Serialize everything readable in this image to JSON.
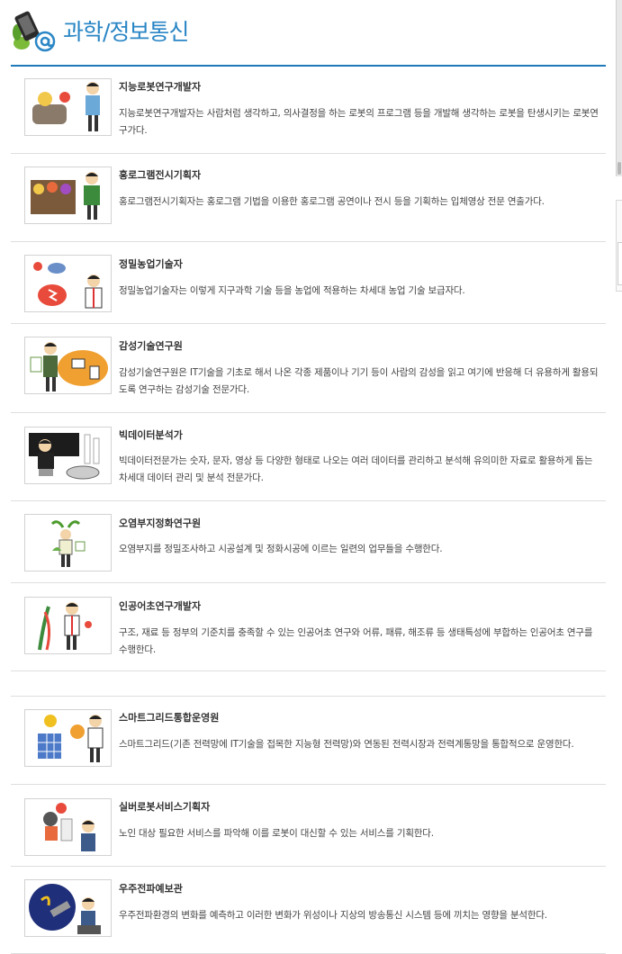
{
  "header": {
    "title": "과학/정보통신"
  },
  "jobs": [
    {
      "title": "지능로봇연구개발자",
      "desc": "지능로봇연구개발자는 사람처럼 생각하고, 의사결정을 하는 로봇의 프로그램 등을 개발해 생각하는 로봇을 탄생시키는 로봇연구가다."
    },
    {
      "title": "홍로그램전시기획자",
      "desc": "홍로그램전시기획자는 홍로그램 기법을 이용한 홍로그램 공연이나 전시 등을 기획하는 입체영상 전문 연출가다."
    },
    {
      "title": "정밀농업기술자",
      "desc": "정밀농업기술자는 이렇게 지구과학 기술 등을 농업에 적용하는 차세대 농업 기술 보급자다."
    },
    {
      "title": "감성기술연구원",
      "desc": "감성기술연구원은 IT기술을 기초로 해서 나온 각종 제품이나 기기 등이 사람의 감성을 읽고 여기에 반응해 더 유용하게 활용되도록 연구하는 감성기술 전문가다."
    },
    {
      "title": "빅데이터분석가",
      "desc": "빅데이터전문가는 숫자, 문자, 영상 등 다양한 형태로 나오는 여러 데이터를 관리하고 분석해 유의미한 자료로 활용하게 돕는 차세대 데이터 관리 및 분석 전문가다."
    },
    {
      "title": "오염부지정화연구원",
      "desc": "오염부지를 정밀조사하고 시공설계 및 정화시공에 이르는 일련의 업무들을 수행한다."
    },
    {
      "title": "인공어초연구개발자",
      "desc": "구조, 재료 등 정부의 기준치를 충족할 수 있는 인공어초 연구와 어류, 패류, 해조류 등 생태특성에 부합하는 인공어초 연구를 수행한다."
    },
    {
      "title": "스마트그리드통합운영원",
      "desc": "스마트그리드(기존 전력망에 IT기술을 접목한 지능형 전력망)와 연동된 전력시장과 전력계통망을 통합적으로 운영한다."
    },
    {
      "title": "실버로봇서비스기획자",
      "desc": "노인 대상 필요한 서비스를 파악해 이를 로봇이 대신할 수 있는 서비스를 기획한다."
    },
    {
      "title": "우주전파예보관",
      "desc": "우주전파환경의 변화를 예측하고 이러한 변화가 위성이나 지상의 방송통신 시스템 등에 끼치는 영향을 분석한다."
    }
  ]
}
